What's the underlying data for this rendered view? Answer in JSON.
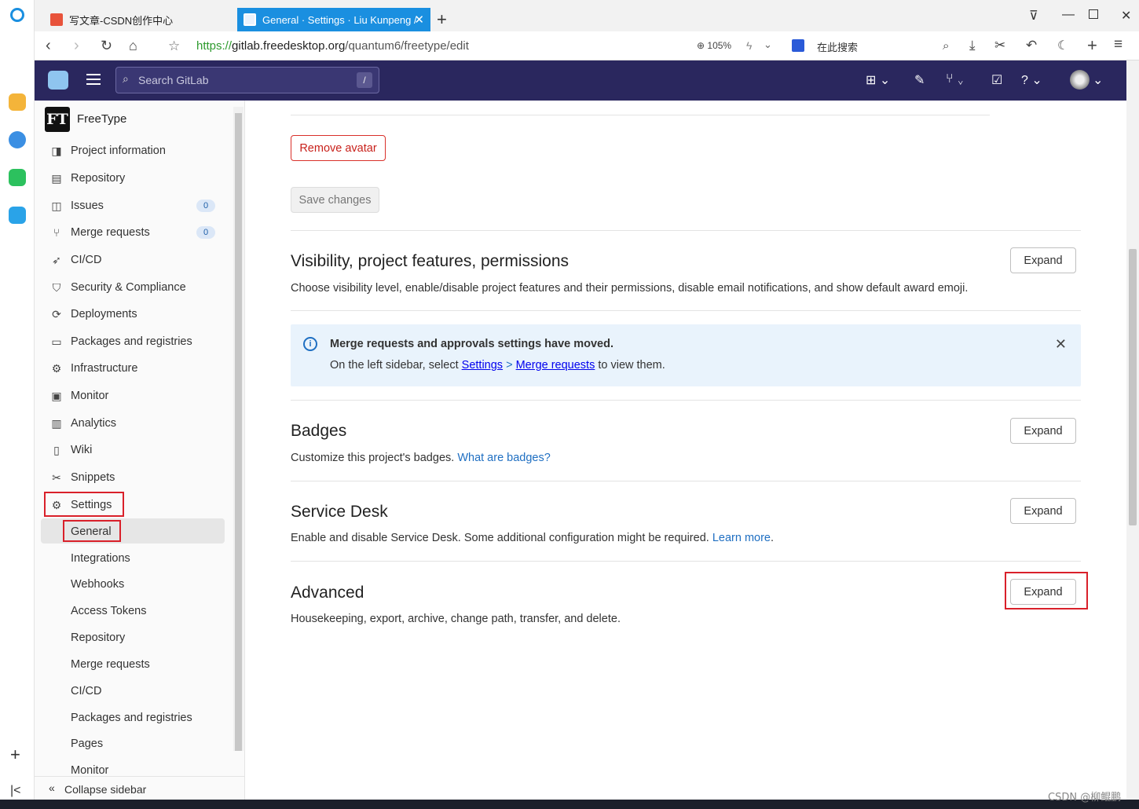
{
  "browser": {
    "tabs": [
      {
        "label": "写文章-CSDN创作中心",
        "favicon_color": "#e8533b"
      },
      {
        "label": "General · Settings · Liu Kunpeng /",
        "favicon_color": "#5b8bd0"
      }
    ],
    "url_scheme": "https://",
    "url_host": "gitlab.freedesktop.org",
    "url_path": "/quantum6/freetype/edit",
    "zoom": "105%",
    "search_placeholder": "在此搜索"
  },
  "gitlab_nav": {
    "search_placeholder": "Search GitLab",
    "search_shortcut": "/"
  },
  "sidebar": {
    "project_badge": "FT",
    "project_name": "FreeType",
    "items": [
      {
        "label": "Project information",
        "icon": "info-icon"
      },
      {
        "label": "Repository",
        "icon": "document-icon"
      },
      {
        "label": "Issues",
        "icon": "issues-icon",
        "count": "0"
      },
      {
        "label": "Merge requests",
        "icon": "merge-request-icon",
        "count": "0"
      },
      {
        "label": "CI/CD",
        "icon": "rocket-icon"
      },
      {
        "label": "Security & Compliance",
        "icon": "shield-icon"
      },
      {
        "label": "Deployments",
        "icon": "deployments-icon"
      },
      {
        "label": "Packages and registries",
        "icon": "package-icon"
      },
      {
        "label": "Infrastructure",
        "icon": "cloud-gear-icon"
      },
      {
        "label": "Monitor",
        "icon": "monitor-icon"
      },
      {
        "label": "Analytics",
        "icon": "chart-icon"
      },
      {
        "label": "Wiki",
        "icon": "book-icon"
      },
      {
        "label": "Snippets",
        "icon": "scissors-icon"
      },
      {
        "label": "Settings",
        "icon": "gear-icon"
      }
    ],
    "settings_sub": [
      "General",
      "Integrations",
      "Webhooks",
      "Access Tokens",
      "Repository",
      "Merge requests",
      "CI/CD",
      "Packages and registries",
      "Pages",
      "Monitor"
    ],
    "collapse_label": "Collapse sidebar"
  },
  "main": {
    "remove_avatar": "Remove avatar",
    "save_changes": "Save changes",
    "sections": [
      {
        "title": "Visibility, project features, permissions",
        "desc": "Choose visibility level, enable/disable project features and their permissions, disable email notifications, and show default award emoji.",
        "button": "Expand"
      },
      {
        "title": "Badges",
        "desc": "Customize this project's badges. ",
        "link": "What are badges?",
        "button": "Expand"
      },
      {
        "title": "Service Desk",
        "desc": "Enable and disable Service Desk. Some additional configuration might be required. ",
        "link": "Learn more",
        "tail": ".",
        "button": "Expand"
      },
      {
        "title": "Advanced",
        "desc": "Housekeeping, export, archive, change path, transfer, and delete.",
        "button": "Expand"
      }
    ],
    "alert": {
      "title": "Merge requests and approvals settings have moved.",
      "prefix": "On the left sidebar, select ",
      "link1": "Settings",
      "sep": " > ",
      "link2": "Merge requests",
      "suffix": " to view them."
    }
  },
  "watermark": "CSDN @柳鲲鹏"
}
